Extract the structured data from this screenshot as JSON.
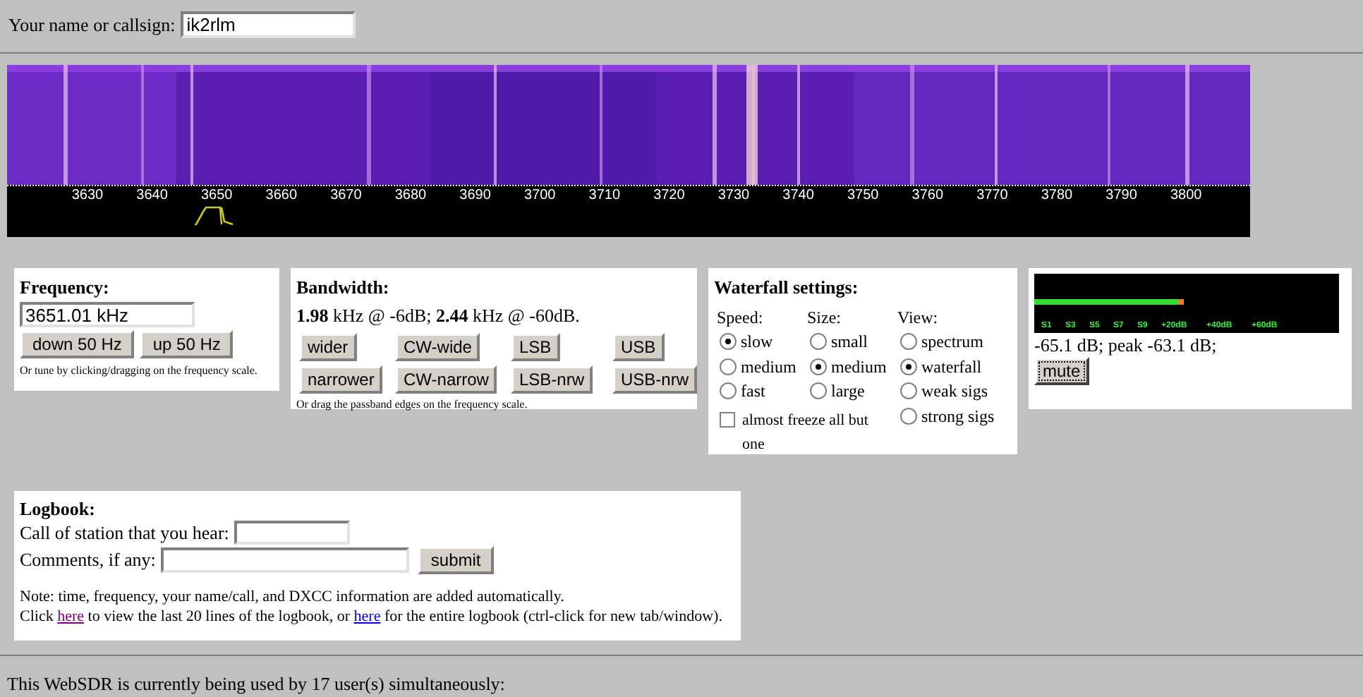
{
  "name_field": {
    "label": "Your name or callsign:",
    "value": "ik2rlm"
  },
  "waterfall": {
    "scale_labels": [
      "3630",
      "3640",
      "3650",
      "3660",
      "3670",
      "3680",
      "3690",
      "3700",
      "3710",
      "3720",
      "3730",
      "3740",
      "3750",
      "3760",
      "3770",
      "3780",
      "3790",
      "3800"
    ]
  },
  "frequency": {
    "title": "Frequency:",
    "value": "3651.01 kHz",
    "buttons": [
      "down 50 Hz",
      "up 50 Hz"
    ],
    "hint": "Or tune by clicking/dragging on the frequency scale."
  },
  "bandwidth": {
    "title": "Bandwidth:",
    "readout": "**1.98** kHz @ -6dB; **2.44** kHz @ -60dB.",
    "buttons": [
      "wider",
      "CW-wide",
      "LSB",
      "USB",
      "narrower",
      "CW-narrow",
      "LSB-nrw",
      "USB-nrw"
    ],
    "hint": "Or drag the passband edges on the frequency scale."
  },
  "waterfall_settings": {
    "title": "Waterfall settings:",
    "groups": [
      {
        "label": "Speed:",
        "options": [
          {
            "label": "slow",
            "selected": true
          },
          {
            "label": "medium",
            "selected": false
          },
          {
            "label": "fast",
            "selected": false
          }
        ]
      },
      {
        "label": "Size:",
        "options": [
          {
            "label": "small",
            "selected": false
          },
          {
            "label": "medium",
            "selected": true
          },
          {
            "label": "large",
            "selected": false
          }
        ]
      },
      {
        "label": "View:",
        "options": [
          {
            "label": "spectrum",
            "selected": false
          },
          {
            "label": "waterfall",
            "selected": true
          },
          {
            "label": "weak sigs",
            "selected": false
          },
          {
            "label": "strong sigs",
            "selected": false
          }
        ]
      }
    ],
    "freeze": {
      "label": "almost freeze all but one",
      "checked": false
    }
  },
  "smeter": {
    "level": 0.49,
    "scale_labels": [
      "S1",
      "S3",
      "S5",
      "S7",
      "S9",
      "+20dB",
      "+40dB",
      "+60dB"
    ],
    "reading": "-65.1 dB; peak -63.1 dB;",
    "mute_button": "mute"
  },
  "logbook": {
    "title": "Logbook:",
    "call_label": "Call of station that you hear:",
    "comments_label": "Comments, if any:",
    "submit": "submit",
    "note": "Note: time, frequency, your name/call, and DXCC information are added automatically.",
    "links_line": [
      {
        "kind": "text",
        "text": "Click "
      },
      {
        "kind": "link",
        "text": "here",
        "visited": true
      },
      {
        "kind": "text",
        "text": " to view the last 20 lines of the logbook, or "
      },
      {
        "kind": "link",
        "text": "here",
        "visited": false
      },
      {
        "kind": "text",
        "text": " for the entire logbook (ctrl-click for new tab/window)."
      }
    ]
  },
  "status": "This WebSDR is currently being used by 17 user(s) simultaneously:"
}
